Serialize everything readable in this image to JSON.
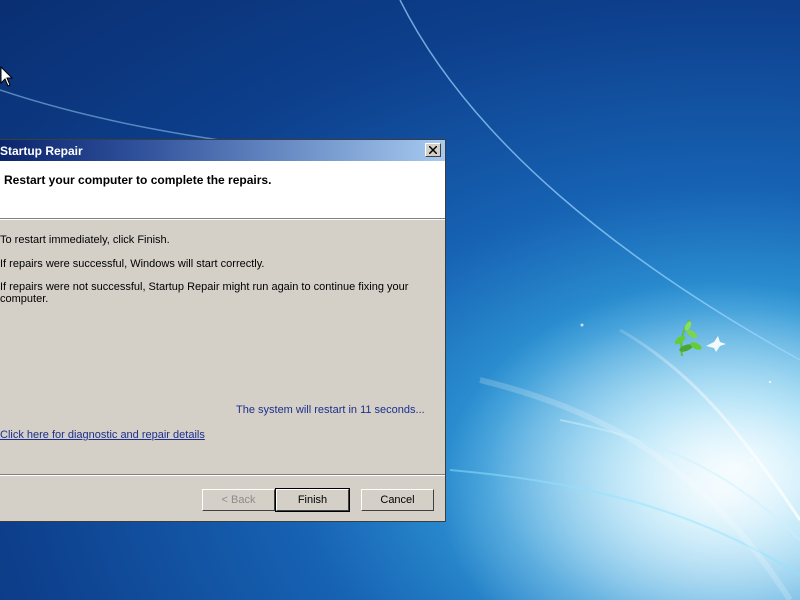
{
  "dialog": {
    "title": "Startup Repair",
    "header": "Restart your computer to complete the repairs.",
    "lines": [
      "To restart immediately, click Finish.",
      "If repairs were successful, Windows will start correctly.",
      "If repairs were not successful, Startup Repair might run again to continue fixing your",
      "computer."
    ],
    "countdown": "The system will restart in 11 seconds...",
    "details_link": "Click here for diagnostic and repair details",
    "buttons": {
      "back": "< Back",
      "finish": "Finish",
      "cancel": "Cancel"
    }
  },
  "icons": {
    "close": "close-icon",
    "cursor": "mouse-pointer-icon",
    "wallpaper_logo": "windows-7-flower-logo"
  },
  "colors": {
    "titlebar_start": "#0a246a",
    "titlebar_end": "#a6caf0",
    "link_blue": "#1d2f8c",
    "dialog_bg": "#d4d0c8",
    "desktop_blue": "#1763b4"
  }
}
